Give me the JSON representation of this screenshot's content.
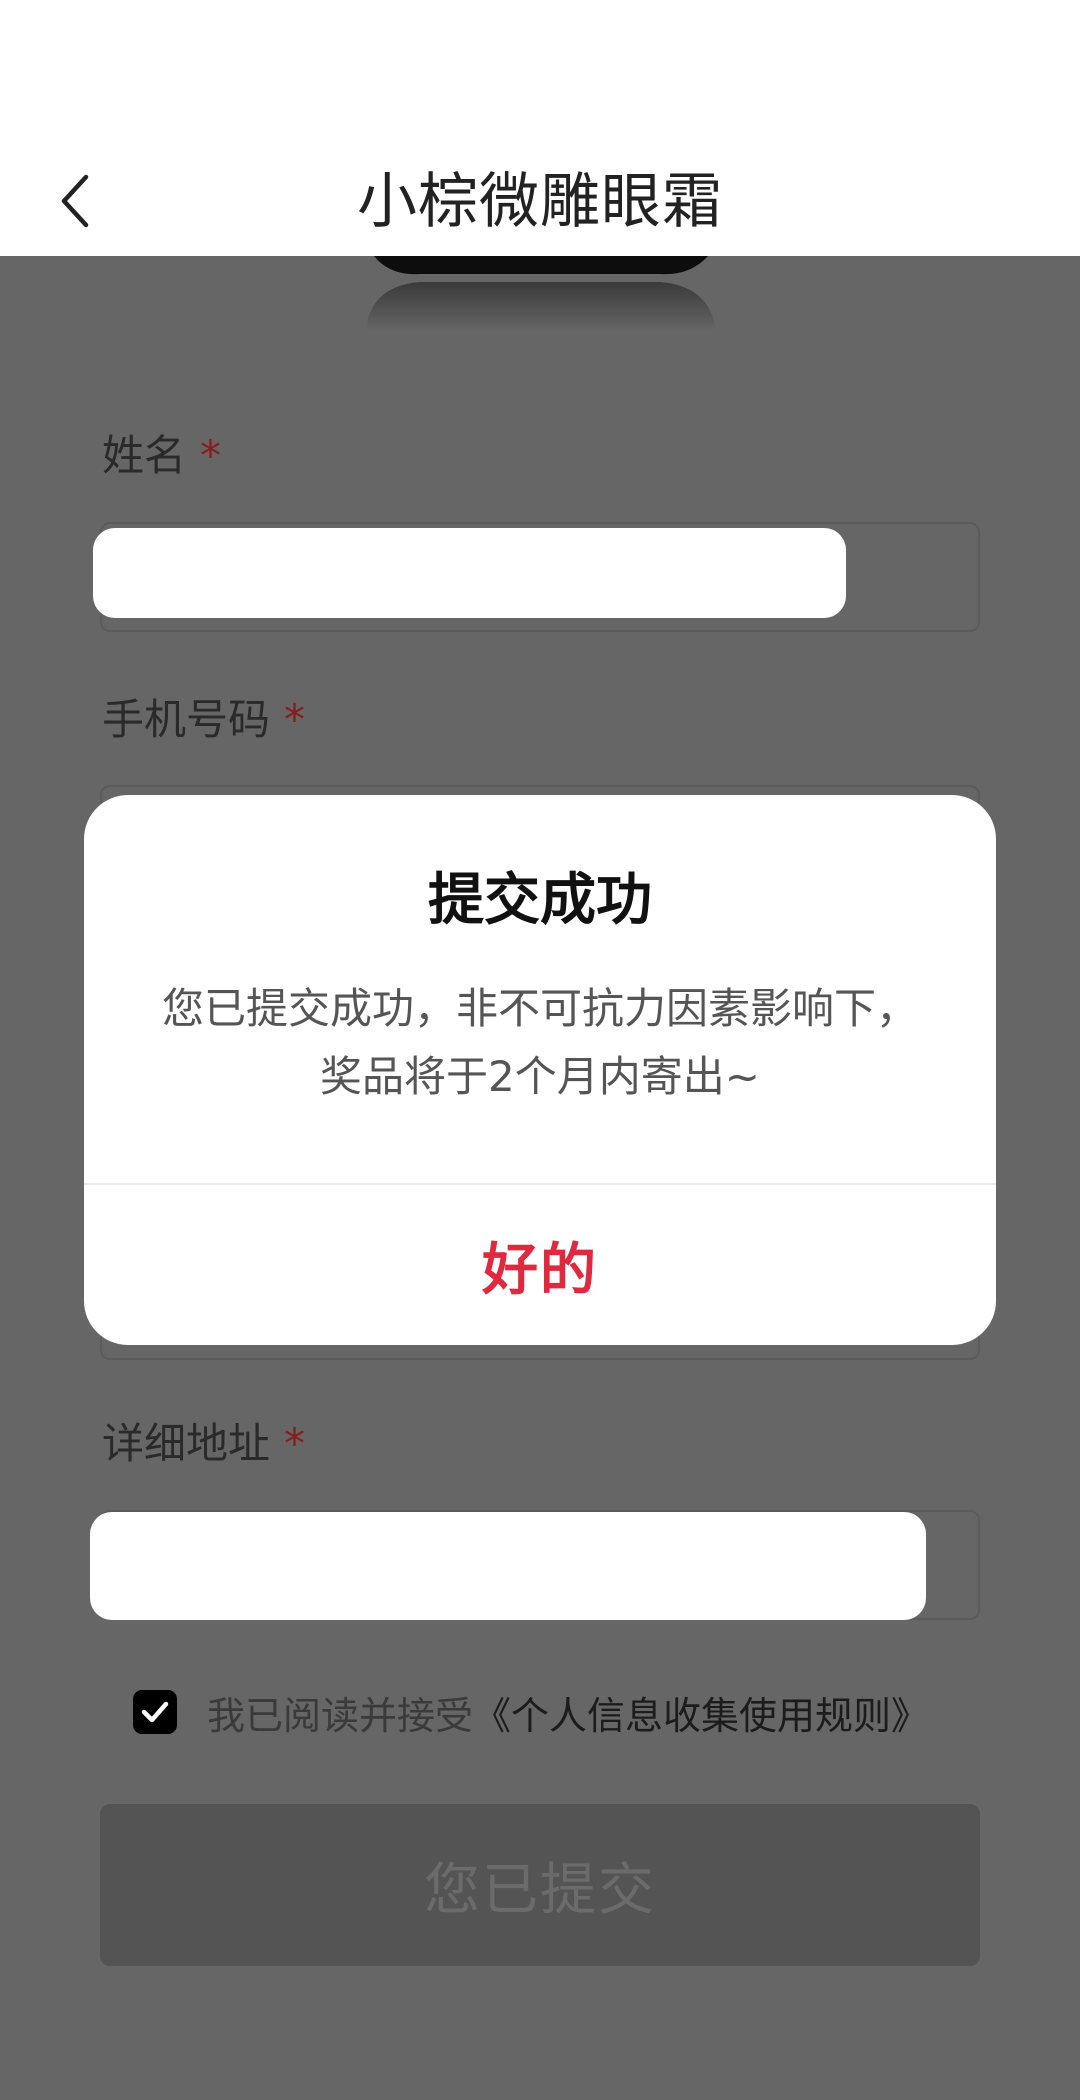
{
  "header": {
    "title": "小棕微雕眼霜",
    "back_icon": "chevron-left-icon"
  },
  "form": {
    "name_label": "姓名",
    "phone_label": "手机号码",
    "address_label": "详细地址",
    "required_mark": "*"
  },
  "agreement": {
    "checked": true,
    "prefix": "我已阅读并接受",
    "link": "《个人信息收集使用规则》"
  },
  "submit": {
    "label": "您已提交"
  },
  "dialog": {
    "title": "提交成功",
    "message": "您已提交成功，非不可抗力因素影响下，奖品将于2个月内寄出~",
    "ok_label": "好的"
  },
  "colors": {
    "overlay": "#666666",
    "accent": "#e0283f",
    "required": "#8a1c1c"
  }
}
